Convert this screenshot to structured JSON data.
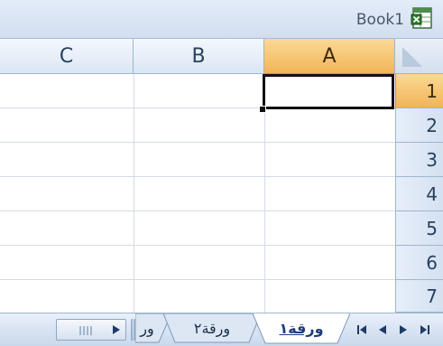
{
  "window": {
    "title": "Book1",
    "title_icon": "excel-workbook-icon"
  },
  "columns": [
    {
      "label": "C",
      "active": false
    },
    {
      "label": "B",
      "active": false
    },
    {
      "label": "A",
      "active": true
    }
  ],
  "rows": [
    {
      "label": "1",
      "active": true
    },
    {
      "label": "2",
      "active": false
    },
    {
      "label": "3",
      "active": false
    },
    {
      "label": "4",
      "active": false
    },
    {
      "label": "5",
      "active": false
    },
    {
      "label": "6",
      "active": false
    },
    {
      "label": "7",
      "active": false
    }
  ],
  "active_cell": "A1",
  "sheet_tabs": [
    {
      "label": "ورقة١",
      "active": true
    },
    {
      "label": "ورقة٢",
      "active": false
    },
    {
      "label": "ور",
      "active": false
    }
  ],
  "nav_buttons": {
    "first": "first-sheet-icon",
    "prev": "previous-sheet-icon",
    "next": "next-sheet-icon",
    "last": "last-sheet-icon"
  },
  "colors": {
    "accent_header": "#f2b457",
    "header_blue": "#dbe6f4",
    "grid_line": "#d4dbe6",
    "titlebar": "#d2def0"
  }
}
